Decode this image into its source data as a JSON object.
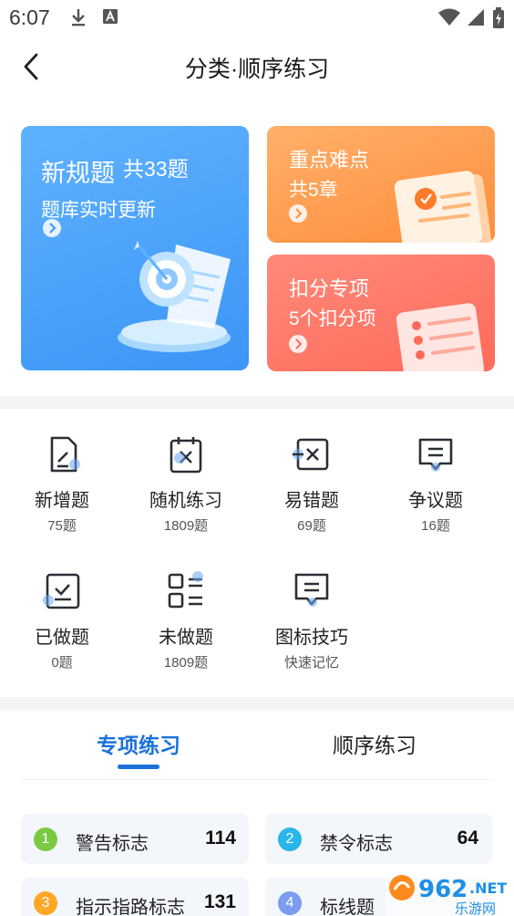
{
  "status_bar": {
    "time": "6:07"
  },
  "nav": {
    "title": "分类·顺序练习"
  },
  "cards": {
    "new_rules": {
      "title": "新规题",
      "count": "共33题",
      "subtitle": "题库实时更新"
    },
    "key_points": {
      "title": "重点难点",
      "subtitle": "共5章"
    },
    "deduction": {
      "title": "扣分专项",
      "subtitle": "5个扣分项"
    }
  },
  "grid": [
    {
      "label": "新增题",
      "sub": "75题",
      "icon": "edit-doc-icon"
    },
    {
      "label": "随机练习",
      "sub": "1809题",
      "icon": "shuffle-calendar-icon"
    },
    {
      "label": "易错题",
      "sub": "69题",
      "icon": "error-x-icon"
    },
    {
      "label": "争议题",
      "sub": "16题",
      "icon": "dispute-chat-icon"
    },
    {
      "label": "已做题",
      "sub": "0题",
      "icon": "done-check-icon"
    },
    {
      "label": "未做题",
      "sub": "1809题",
      "icon": "list-grid-icon"
    },
    {
      "label": "图标技巧",
      "sub": "快速记忆",
      "icon": "tips-chat-icon"
    }
  ],
  "tabs": {
    "active": "专项练习",
    "inactive": "顺序练习"
  },
  "list": [
    {
      "num": "1",
      "name": "警告标志",
      "count": "114",
      "color": "#7ac943"
    },
    {
      "num": "2",
      "name": "禁令标志",
      "count": "64",
      "color": "#29b6e8"
    },
    {
      "num": "3",
      "name": "指示指路标志",
      "count": "131",
      "color": "#ffa726"
    },
    {
      "num": "4",
      "name": "标线题",
      "count": "",
      "color": "#7c9cf0"
    }
  ],
  "watermark": {
    "text": "962.NET",
    "sub": "乐游网"
  },
  "colors": {
    "accent": "#1b72d9",
    "blue_card": "#4aa3fb",
    "orange_card": "#ff9a4a",
    "red_card": "#ff7565"
  }
}
